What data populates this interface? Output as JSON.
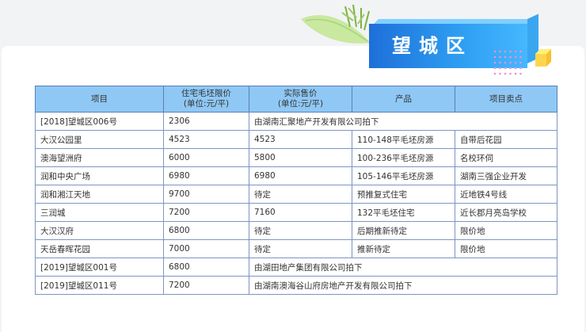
{
  "header": {
    "title": "望城区"
  },
  "table": {
    "columns": [
      {
        "line1": "项目",
        "line2": ""
      },
      {
        "line1": "住宅毛坯限价",
        "line2": "(单位:元/平)"
      },
      {
        "line1": "实际售价",
        "line2": "(单位:元/平)"
      },
      {
        "line1": "产品",
        "line2": ""
      },
      {
        "line1": "项目卖点",
        "line2": ""
      }
    ],
    "rows": [
      {
        "project": "[2018]望城区006号",
        "limit_price": "2306",
        "note": "由湖南汇聚地产开发有限公司拍下"
      },
      {
        "project": "大汉公园里",
        "limit_price": "4523",
        "actual_price": "4523",
        "product": "110-148平毛坯房源",
        "selling_point": "自带后花园"
      },
      {
        "project": "澳海望洲府",
        "limit_price": "6000",
        "actual_price": "5800",
        "product": "100-236平毛坯房源",
        "selling_point": "名校环伺"
      },
      {
        "project": "润和中央广场",
        "limit_price": "6980",
        "actual_price": "6980",
        "product": "105-146平毛坯房源",
        "selling_point": "湖南三强企业开发"
      },
      {
        "project": "润和湘江天地",
        "limit_price": "9700",
        "actual_price": "待定",
        "product": "预推复式住宅",
        "selling_point": "近地铁4号线"
      },
      {
        "project": "三润城",
        "limit_price": "7200",
        "actual_price": "7160",
        "product": "132平毛坯住宅",
        "selling_point": "近长郡月亮岛学校"
      },
      {
        "project": "大汉汉府",
        "limit_price": "6800",
        "actual_price": "待定",
        "product": "后期推新待定",
        "selling_point": "限价地"
      },
      {
        "project": "天岳春晖花园",
        "limit_price": "7000",
        "actual_price": "待定",
        "product": "推新待定",
        "selling_point": "限价地"
      },
      {
        "project": "[2019]望城区001号",
        "limit_price": "6800",
        "note": "由湖田地产集团有限公司拍下"
      },
      {
        "project": "[2019]望城区011号",
        "limit_price": "7200",
        "note": "由湖南澳海谷山府房地产开发有限公司拍下"
      }
    ]
  }
}
